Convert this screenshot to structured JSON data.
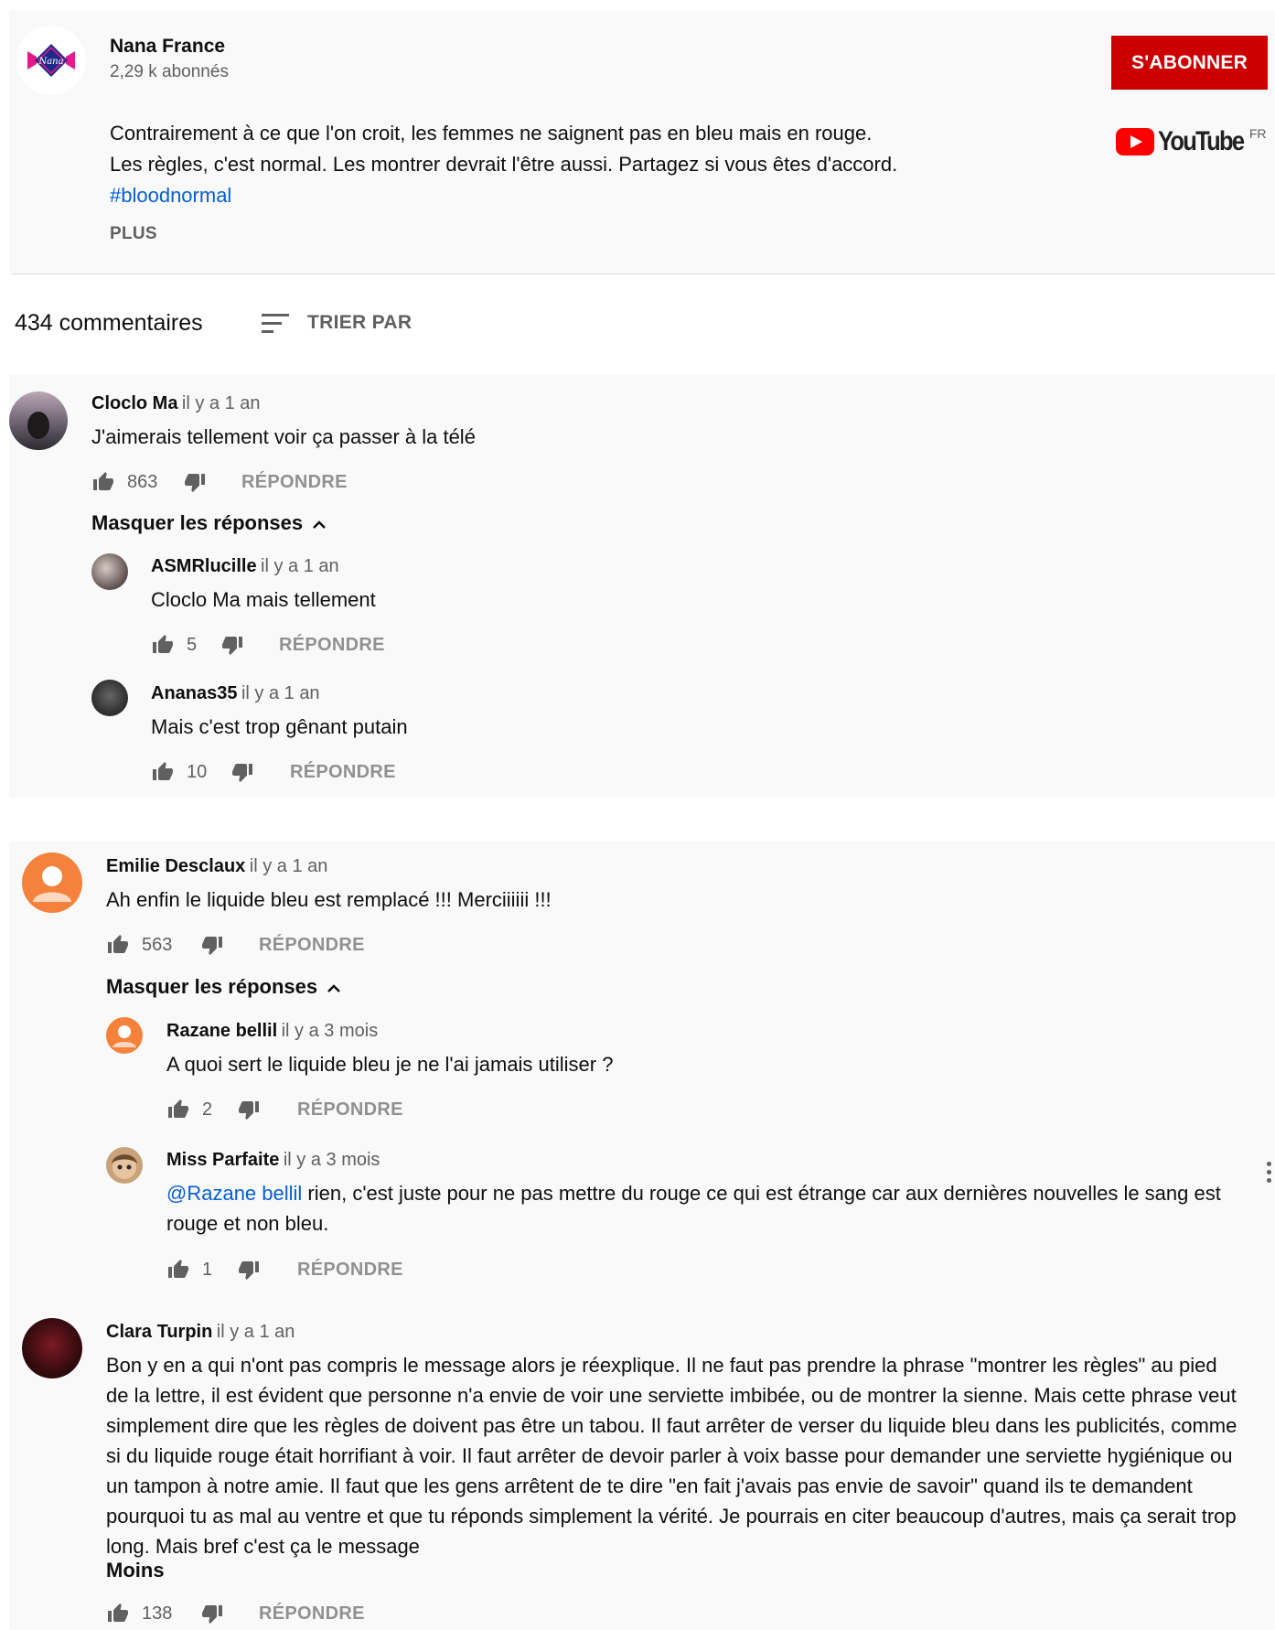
{
  "channel": {
    "name": "Nana France",
    "subscribers": "2,29 k abonnés",
    "logo_text": "Nana",
    "subscribe_label": "S'ABONNER",
    "youtube_word": "YouTube",
    "youtube_region": "FR"
  },
  "description": {
    "line1": "Contrairement à ce que l'on croit, les femmes ne saignent pas en bleu mais en rouge.",
    "line2": "Les règles, c'est normal. Les montrer devrait l'être aussi. Partagez si vous êtes d'accord.",
    "hashtag": "#bloodnormal",
    "more": "PLUS"
  },
  "comments_header": {
    "count": "434 commentaires",
    "sort_label": "TRIER PAR"
  },
  "reply_label": "RÉPONDRE",
  "hide_replies": "Masquer les réponses",
  "less_label": "Moins",
  "threads": [
    {
      "author": "Cloclo Ma",
      "time": "il y a 1 an",
      "text": "J'aimerais tellement voir ça passer à la télé",
      "likes": "863",
      "replies": [
        {
          "author": "ASMRlucille",
          "time": "il y a 1 an",
          "text": "Cloclo Ma mais tellement",
          "likes": "5"
        },
        {
          "author": "Ananas35",
          "time": "il y a 1 an",
          "text": "Mais c'est trop gênant putain",
          "likes": "10"
        }
      ]
    },
    {
      "author": "Emilie Desclaux",
      "time": "il y a 1 an",
      "text": "Ah enfin le liquide bleu est remplacé !!! Merciiiiii !!!",
      "likes": "563",
      "replies": [
        {
          "author": "Razane bellil",
          "time": "il y a 3 mois",
          "text": "A quoi sert le liquide bleu je ne l'ai jamais utiliser ?",
          "likes": "2"
        },
        {
          "author": "Miss Parfaite",
          "time": "il y a 3 mois",
          "mention": "@Razane bellil",
          "text": " rien, c'est juste pour ne pas mettre du rouge ce qui est étrange car aux dernières nouvelles le sang est rouge et non bleu.",
          "likes": "1"
        }
      ]
    },
    {
      "author": "Clara Turpin",
      "time": "il y a 1 an",
      "text": "Bon y en a qui n'ont pas compris le message alors je réexplique. Il ne faut pas prendre la phrase \"montrer les règles\" au pied de la lettre,  il est évident que personne n'a envie de voir une serviette imbibée, ou de montrer la sienne. Mais cette phrase veut simplement dire que les règles de doivent pas être un tabou. Il faut arrêter de verser du liquide bleu dans les publicités, comme si du liquide rouge était horrifiant à voir. Il faut arrêter de devoir parler à voix basse pour demander une serviette hygiénique ou un tampon à notre amie. Il faut que les gens arrêtent de te dire \"en fait j'avais pas envie de savoir\" quand ils te demandent pourquoi tu as mal au ventre et que tu réponds simplement la vérité. Je pourrais en citer beaucoup d'autres, mais ça serait trop long. Mais bref c'est ça le message",
      "likes": "138"
    }
  ]
}
